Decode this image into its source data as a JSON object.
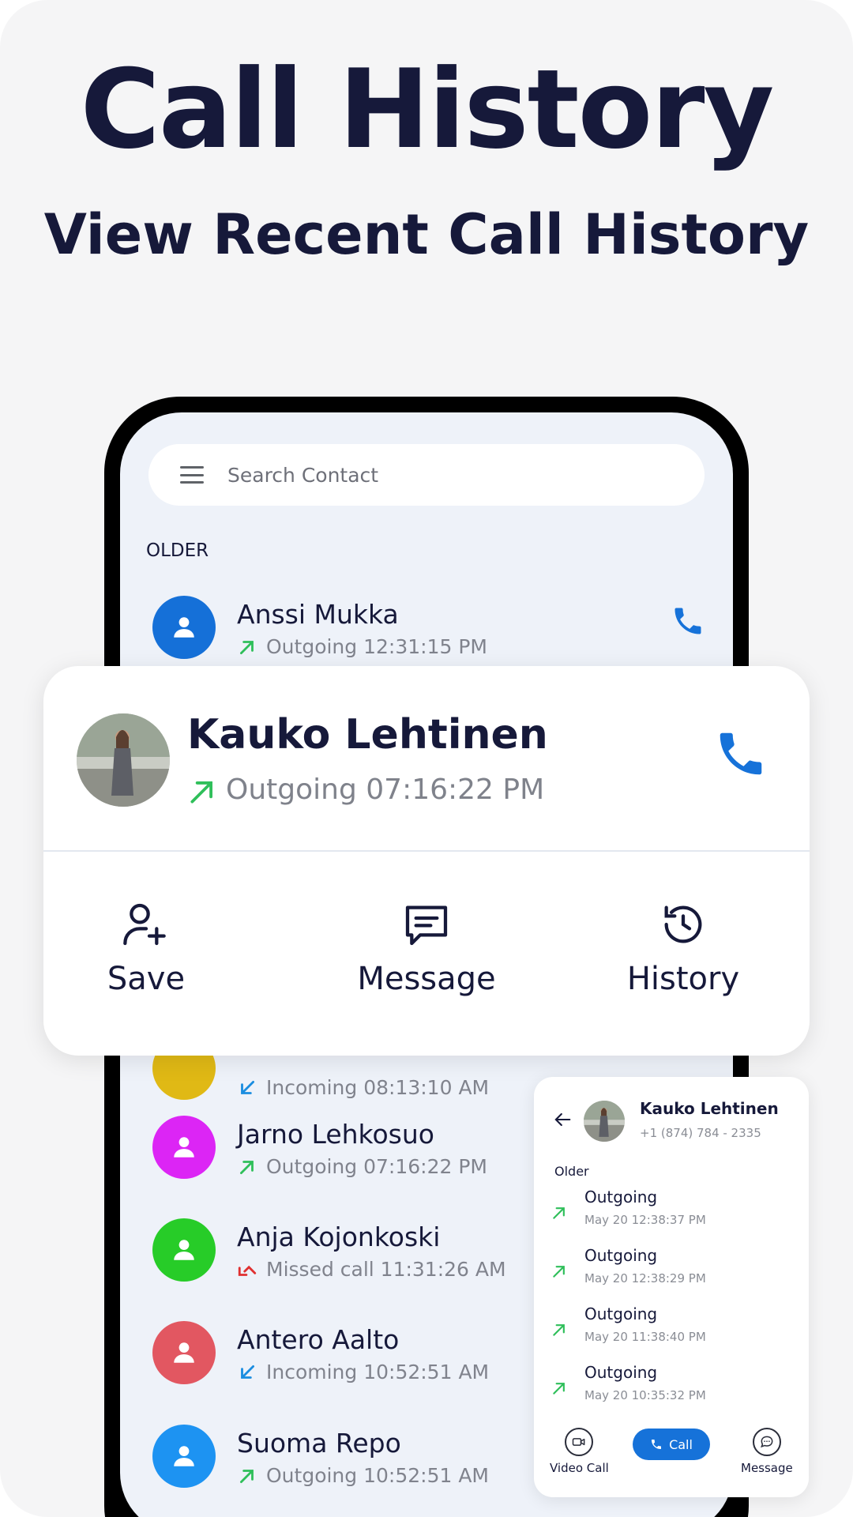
{
  "promo": {
    "headline": "Call History",
    "subheadline": "View Recent Call History"
  },
  "search": {
    "placeholder": "Search Contact"
  },
  "section_label": "OLDER",
  "contacts": [
    {
      "name": "Anssi Mukka",
      "status": "Outgoing 12:31:15 PM",
      "type": "outgoing",
      "avatar_color": "#1570d8"
    },
    {
      "name": "",
      "status": "Incoming 08:13:10 AM",
      "type": "incoming",
      "avatar_color": "#e0b915"
    },
    {
      "name": "Jarno Lehkosuo",
      "status": "Outgoing 07:16:22 PM",
      "type": "outgoing",
      "avatar_color": "#dc25f5"
    },
    {
      "name": "Anja Kojonkoski",
      "status": "Missed call 11:31:26 AM",
      "type": "missed",
      "avatar_color": "#27cc28"
    },
    {
      "name": "Antero Aalto",
      "status": "Incoming 10:52:51 AM",
      "type": "incoming",
      "avatar_color": "#e25761"
    },
    {
      "name": "Suoma Repo",
      "status": "Outgoing 10:52:51 AM",
      "type": "outgoing",
      "avatar_color": "#1d93f2"
    }
  ],
  "popup": {
    "name": "Kauko Lehtinen",
    "status": "Outgoing 07:16:22 PM",
    "actions": {
      "save": "Save",
      "message": "Message",
      "history": "History"
    }
  },
  "history_card": {
    "name": "Kauko Lehtinen",
    "number": "+1 (874) 784 - 2335",
    "section": "Older",
    "entries": [
      {
        "type": "Outgoing",
        "date": "May 20 12:38:37 PM"
      },
      {
        "type": "Outgoing",
        "date": "May 20 12:38:29 PM"
      },
      {
        "type": "Outgoing",
        "date": "May 20 11:38:40 PM"
      },
      {
        "type": "Outgoing",
        "date": "May 20 10:35:32 PM"
      }
    ],
    "actions": {
      "video_call": "Video Call",
      "call": "Call",
      "message": "Message"
    }
  },
  "colors": {
    "accent": "#1672d9",
    "outgoing_arrow": "#2fbf5a",
    "incoming_arrow": "#1a8de0",
    "missed_arrow": "#e03030",
    "text_dark": "#16193a",
    "text_muted": "#80838d"
  }
}
